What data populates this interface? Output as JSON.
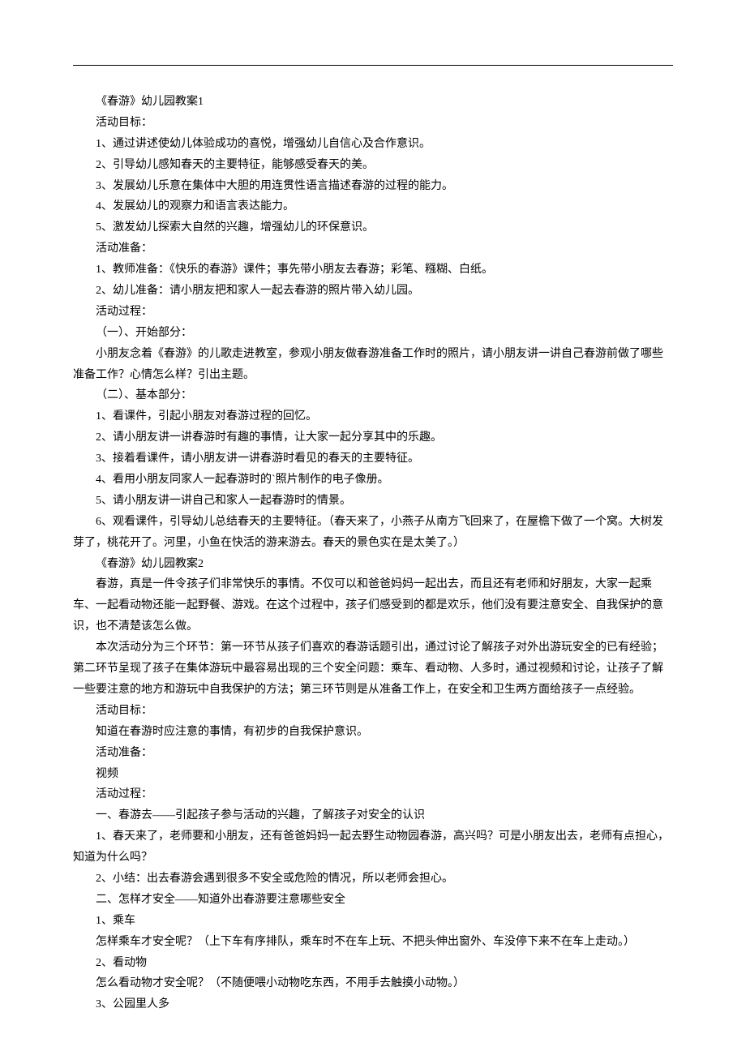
{
  "lines": [
    "《春游》幼儿园教案1",
    "活动目标：",
    "1、通过讲述使幼儿体验成功的喜悦，增强幼儿自信心及合作意识。",
    "2、引导幼儿感知春天的主要特征，能够感受春天的美。",
    "3、发展幼儿乐意在集体中大胆的用连贯性语言描述春游的过程的能力。",
    "4、发展幼儿的观察力和语言表达能力。",
    "5、激发幼儿探索大自然的兴趣，增强幼儿的环保意识。",
    "活动准备：",
    "1、教师准备：《快乐的春游》课件；事先带小朋友去春游；彩笔、糨糊、白纸。",
    "2、幼儿准备：请小朋友把和家人一起去春游的照片带入幼儿园。",
    "活动过程：",
    "（一）、开始部分：",
    "小朋友念着《春游》的儿歌走进教室，参观小朋友做春游准备工作时的照片，请小朋友讲一讲自己春游前做了哪些准备工作？心情怎么样？引出主题。",
    "（二）、基本部分：",
    "1、看课件，引起小朋友对春游过程的回忆。",
    "2、请小朋友讲一讲春游时有趣的事情，让大家一起分享其中的乐趣。",
    "3、接着看课件，请小朋友讲一讲春游时看见的春天的主要特征。",
    "4、看用小朋友同家人一起春游时的`照片制作的电子像册。",
    "5、请小朋友讲一讲自己和家人一起春游时的情景。",
    "6、观看课件，引导幼儿总结春天的主要特征。（春天来了，小燕子从南方飞回来了，在屋檐下做了一个窝。大树发芽了，桃花开了。河里，小鱼在快活的游来游去。春天的景色实在是太美了。）",
    "《春游》幼儿园教案2",
    "春游，真是一件令孩子们非常快乐的事情。不仅可以和爸爸妈妈一起出去，而且还有老师和好朋友，大家一起乘车、一起看动物还能一起野餐、游戏。在这个过程中，孩子们感受到的都是欢乐，他们没有要注意安全、自我保护的意识，也不清楚该怎么做。",
    "本次活动分为三个环节：第一环节从孩子们喜欢的春游话题引出，通过讨论了解孩子对外出游玩安全的已有经验；第二环节呈现了孩子在集体游玩中最容易出现的三个安全问题：乘车、看动物、人多时，通过视频和讨论，让孩子了解一些要注意的地方和游玩中自我保护的方法；第三环节则是从准备工作上，在安全和卫生两方面给孩子一点经验。",
    "活动目标：",
    "知道在春游时应注意的事情，有初步的自我保护意识。",
    "活动准备：",
    "视频",
    "活动过程：",
    "一、春游去——引起孩子参与活动的兴趣，了解孩子对安全的认识",
    "1、春天来了，老师要和小朋友，还有爸爸妈妈一起去野生动物园春游，高兴吗？可是小朋友出去，老师有点担心，知道为什么吗？",
    "2、小结：出去春游会遇到很多不安全或危险的情况，所以老师会担心。",
    "二、怎样才安全——知道外出春游要注意哪些安全",
    "1、乘车",
    "怎样乘车才安全呢？（上下车有序排队，乘车时不在车上玩、不把头伸出窗外、车没停下来不在车上走动。）",
    "2、看动物",
    "怎么看动物才安全呢？（不随便喂小动物吃东西，不用手去触摸小动物。）",
    "3、公园里人多"
  ],
  "wrappedLines": [
    12,
    19,
    21,
    22
  ]
}
